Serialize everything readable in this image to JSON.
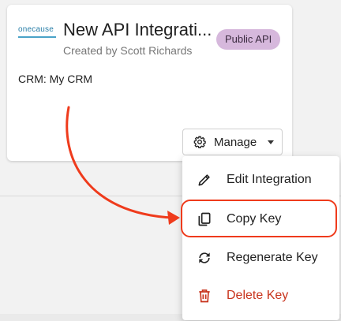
{
  "card": {
    "logo_text": "onecause",
    "title": "New API Integrati...",
    "created_by": "Created by Scott Richards",
    "badge": "Public API",
    "crm": "CRM: My CRM"
  },
  "manage": {
    "label": "Manage"
  },
  "menu": {
    "items": [
      {
        "label": "Edit Integration",
        "icon": "pencil-icon"
      },
      {
        "label": "Copy Key",
        "icon": "copy-icon"
      },
      {
        "label": "Regenerate Key",
        "icon": "refresh-icon"
      },
      {
        "label": "Delete Key",
        "icon": "trash-icon"
      }
    ]
  },
  "colors": {
    "badge_bg": "#d6b8dc",
    "danger": "#c8331c",
    "annotation": "#ef3b1c"
  }
}
